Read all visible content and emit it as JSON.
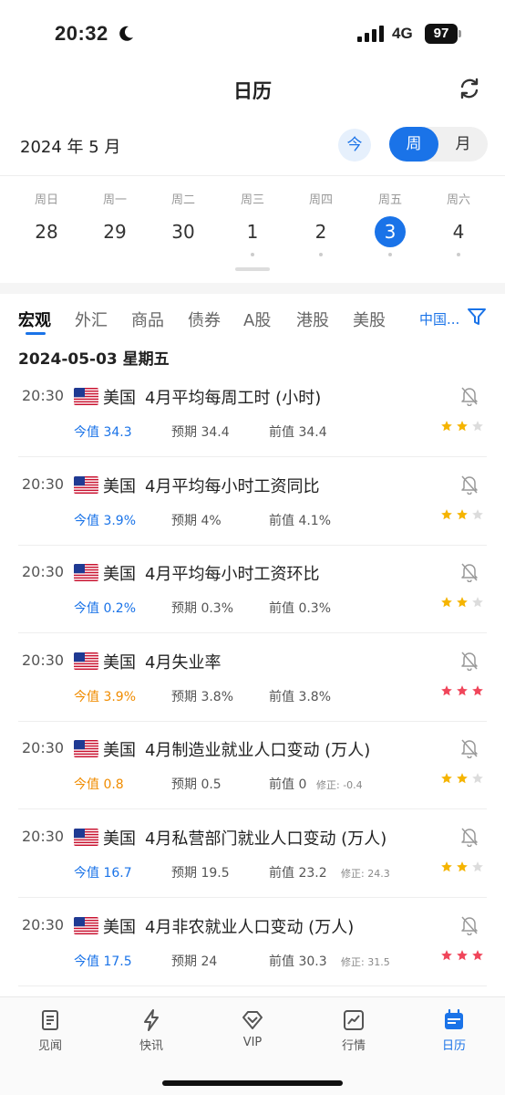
{
  "status_bar": {
    "time": "20:32",
    "network": "4G",
    "battery": "97"
  },
  "header": {
    "title": "日历"
  },
  "month_row": {
    "month_label": "2024 年 5 月",
    "today_label": "今",
    "week_label": "周",
    "month_toggle_label": "月"
  },
  "week": {
    "days": [
      {
        "name": "周日",
        "num": "28"
      },
      {
        "name": "周一",
        "num": "29"
      },
      {
        "name": "周二",
        "num": "30"
      },
      {
        "name": "周三",
        "num": "1"
      },
      {
        "name": "周四",
        "num": "2"
      },
      {
        "name": "周五",
        "num": "3"
      },
      {
        "name": "周六",
        "num": "4"
      }
    ],
    "selected_index": 5
  },
  "tabs": {
    "items": [
      "宏观",
      "外汇",
      "商品",
      "债券",
      "A股",
      "港股",
      "美股"
    ],
    "active_index": 0,
    "region_filter": "中国..."
  },
  "date_heading": "2024-05-03 星期五",
  "labels": {
    "actual": "今值",
    "forecast": "预期",
    "previous": "前值"
  },
  "events": [
    {
      "time": "20:30",
      "country": "美国",
      "title": "4月平均每周工时 (小时)",
      "actual": "34.3",
      "forecast": "34.4",
      "previous": "34.4",
      "revised": "",
      "actual_color": "blue",
      "stars": 2,
      "star_color": "#f5b400"
    },
    {
      "time": "20:30",
      "country": "美国",
      "title": "4月平均每小时工资同比",
      "actual": "3.9%",
      "forecast": "4%",
      "previous": "4.1%",
      "revised": "",
      "actual_color": "blue",
      "stars": 2,
      "star_color": "#f5b400"
    },
    {
      "time": "20:30",
      "country": "美国",
      "title": "4月平均每小时工资环比",
      "actual": "0.2%",
      "forecast": "0.3%",
      "previous": "0.3%",
      "revised": "",
      "actual_color": "blue",
      "stars": 2,
      "star_color": "#f5b400"
    },
    {
      "time": "20:30",
      "country": "美国",
      "title": "4月失业率",
      "actual": "3.9%",
      "forecast": "3.8%",
      "previous": "3.8%",
      "revised": "",
      "actual_color": "orange",
      "stars": 3,
      "star_color": "#f0455a"
    },
    {
      "time": "20:30",
      "country": "美国",
      "title": "4月制造业就业人口变动 (万人)",
      "actual": "0.8",
      "forecast": "0.5",
      "previous": "0",
      "revised": "修正: -0.4",
      "actual_color": "orange",
      "stars": 2,
      "star_color": "#f5b400"
    },
    {
      "time": "20:30",
      "country": "美国",
      "title": "4月私营部门就业人口变动 (万人)",
      "actual": "16.7",
      "forecast": "19.5",
      "previous": "23.2",
      "revised": "修正: 24.3",
      "actual_color": "blue",
      "stars": 2,
      "star_color": "#f5b400"
    },
    {
      "time": "20:30",
      "country": "美国",
      "title": "4月非农就业人口变动 (万人)",
      "actual": "17.5",
      "forecast": "24",
      "previous": "30.3",
      "revised": "修正: 31.5",
      "actual_color": "blue",
      "stars": 3,
      "star_color": "#f0455a"
    }
  ],
  "tabbar": {
    "items": [
      {
        "label": "见闻",
        "icon": "news-icon"
      },
      {
        "label": "快讯",
        "icon": "lightning-icon"
      },
      {
        "label": "VIP",
        "icon": "diamond-icon"
      },
      {
        "label": "行情",
        "icon": "chart-icon"
      },
      {
        "label": "日历",
        "icon": "calendar-icon"
      }
    ],
    "active_index": 4
  },
  "colors": {
    "accent": "#1a73e8",
    "orange": "#f08c00",
    "star_gold": "#f5b400",
    "star_red": "#f0455a"
  }
}
